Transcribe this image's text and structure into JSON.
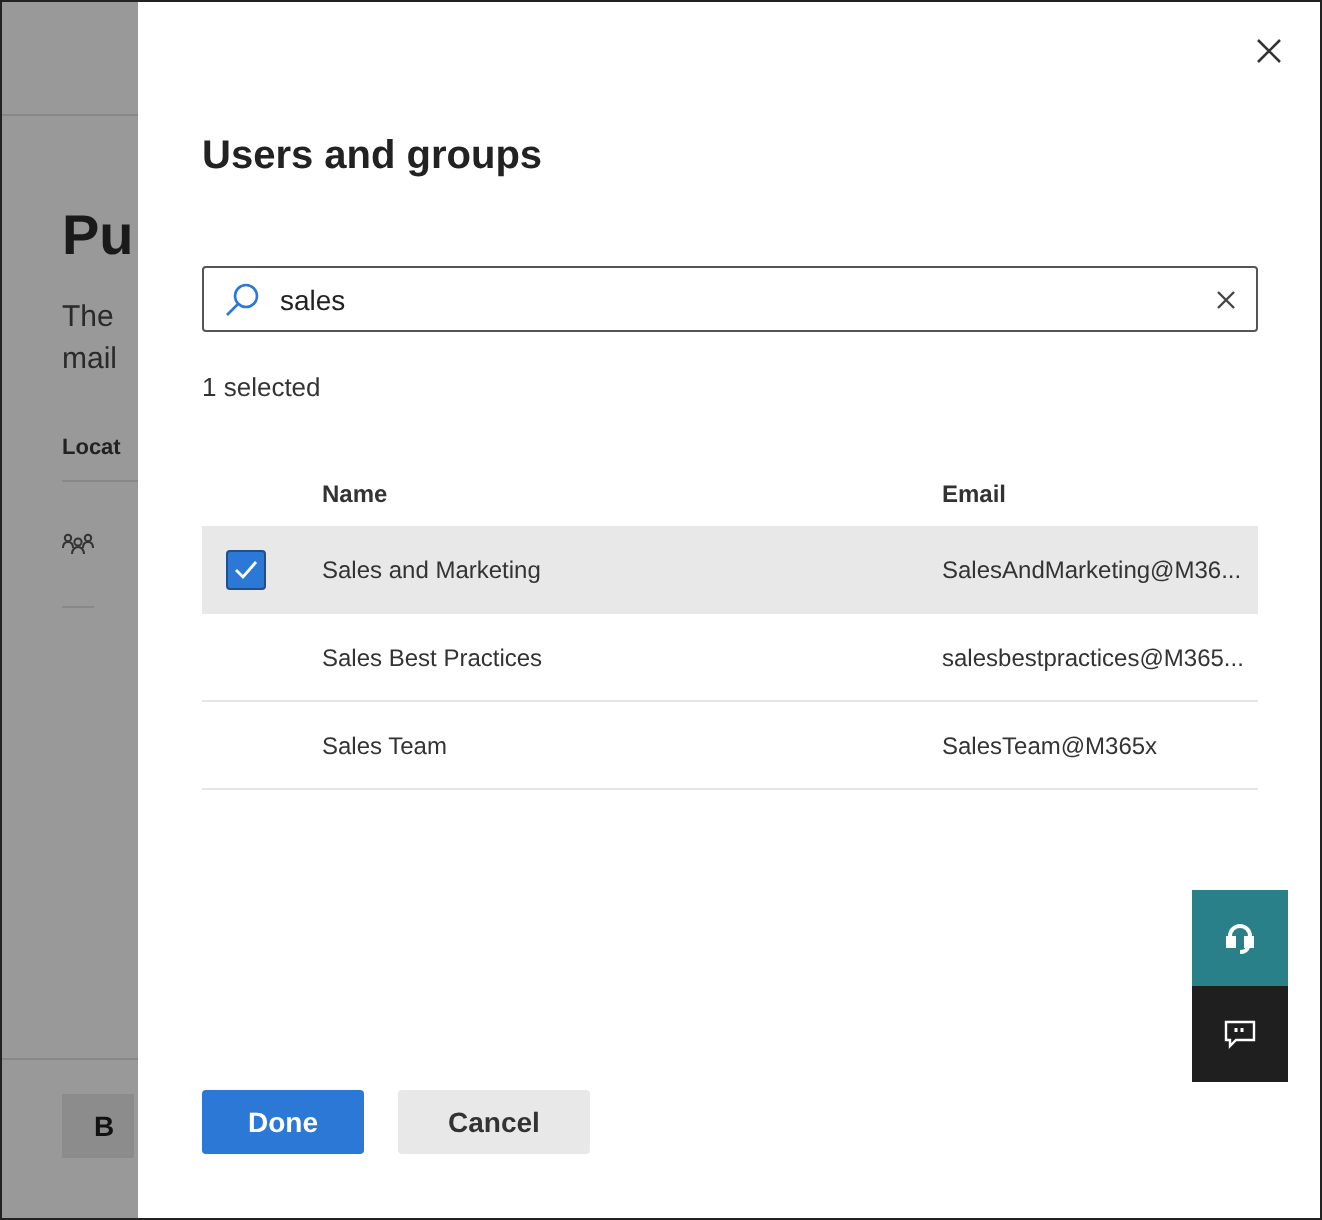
{
  "background_page": {
    "heading": "Pu",
    "description_lines": [
      "The",
      "mail"
    ],
    "column_header": "Locat",
    "back_button": "B"
  },
  "panel": {
    "title": "Users and groups",
    "search": {
      "value": "sales"
    },
    "selection_count": "1 selected",
    "table": {
      "columns": [
        "Name",
        "Email"
      ],
      "rows": [
        {
          "name": "Sales and Marketing",
          "email": "SalesAndMarketing@M36...",
          "selected": true
        },
        {
          "name": "Sales Best Practices",
          "email": "salesbestpractices@M365...",
          "selected": false
        },
        {
          "name": "Sales Team",
          "email": "SalesTeam@M365x",
          "selected": false
        }
      ]
    },
    "buttons": [
      {
        "label": "Done",
        "kind": "primary"
      },
      {
        "label": "Cancel",
        "kind": "secondary"
      }
    ]
  }
}
